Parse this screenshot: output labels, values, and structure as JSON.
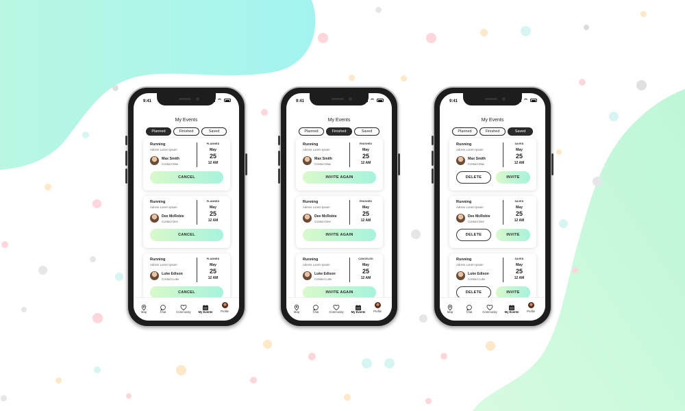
{
  "status_time": "9:41",
  "screen_title": "My Events",
  "tab_labels": [
    "Planned",
    "Finished",
    "Saved"
  ],
  "nav_items": [
    {
      "label": "Map",
      "icon": "map-pin-icon"
    },
    {
      "label": "Chat",
      "icon": "chat-bubble-icon"
    },
    {
      "label": "Community",
      "icon": "heart-icon"
    },
    {
      "label": "My Events",
      "icon": "calendar-icon"
    },
    {
      "label": "Profile",
      "icon": "avatar"
    }
  ],
  "colors": {
    "button_gradient_start": "#d9f9cb",
    "button_gradient_end": "#a6f3dc",
    "active_tab": "#2b2b2b",
    "blob_top_left": "#a8f6ee",
    "blob_bottom_right": "#c6f9dd"
  },
  "phones": [
    {
      "active_tab": 0,
      "cards": [
        {
          "activity": "Running",
          "address": "Adress Lorem Ipsum",
          "contact_name": "Max Smith",
          "contact_action": "Contact Max",
          "status": "PLANNED",
          "month": "May",
          "day": "25",
          "time": "12 AM",
          "buttons": [
            "CANCEL"
          ]
        },
        {
          "activity": "Running",
          "address": "Adress Lorem Ipsum",
          "contact_name": "Dee McRobie",
          "contact_action": "Contact Dee",
          "status": "PLANNED",
          "month": "May",
          "day": "25",
          "time": "12 AM",
          "buttons": [
            "CANCEL"
          ]
        },
        {
          "activity": "Running",
          "address": "Adress Lorem Ipsum",
          "contact_name": "Luke Edison",
          "contact_action": "Contact Luke",
          "status": "PLANNED",
          "month": "May",
          "day": "25",
          "time": "12 AM",
          "buttons": [
            "CANCEL"
          ]
        }
      ]
    },
    {
      "active_tab": 1,
      "cards": [
        {
          "activity": "Running",
          "address": "Adress Lorem Ipsum",
          "contact_name": "Max Smith",
          "contact_action": "Contact Max",
          "status": "FINISHED",
          "month": "May",
          "day": "25",
          "time": "12 AM",
          "buttons": [
            "INVITE AGAIN"
          ]
        },
        {
          "activity": "Running",
          "address": "Adress Lorem Ipsum",
          "contact_name": "Dee McRobie",
          "contact_action": "Contact Dee",
          "status": "FINISHED",
          "month": "May",
          "day": "25",
          "time": "12 AM",
          "buttons": [
            "INVITE AGAIN"
          ]
        },
        {
          "activity": "Running",
          "address": "Adress Lorem Ipsum",
          "contact_name": "Luke Edison",
          "contact_action": "Contact Luke",
          "status": "CANCELED",
          "month": "May",
          "day": "25",
          "time": "12 AM",
          "buttons": [
            "INVITE AGAIN"
          ]
        }
      ]
    },
    {
      "active_tab": 2,
      "cards": [
        {
          "activity": "Running",
          "address": "Adress Lorem Ipsum",
          "contact_name": "Max Smith",
          "contact_action": "Contact Max",
          "status": "SAVED",
          "month": "May",
          "day": "25",
          "time": "12 AM",
          "buttons": [
            "DELETE",
            "INVITE"
          ]
        },
        {
          "activity": "Running",
          "address": "Adress Lorem Ipsum",
          "contact_name": "Dee McRobie",
          "contact_action": "Contact Dee",
          "status": "SAVED",
          "month": "May",
          "day": "25",
          "time": "12 AM",
          "buttons": [
            "DELETE",
            "INVITE"
          ]
        },
        {
          "activity": "Running",
          "address": "Adress Lorem Ipsum",
          "contact_name": "Luke Edison",
          "contact_action": "Contact Luke",
          "status": "SAVED",
          "month": "May",
          "day": "25",
          "time": "12 AM",
          "buttons": [
            "DELETE",
            "INVITE"
          ]
        }
      ]
    }
  ]
}
